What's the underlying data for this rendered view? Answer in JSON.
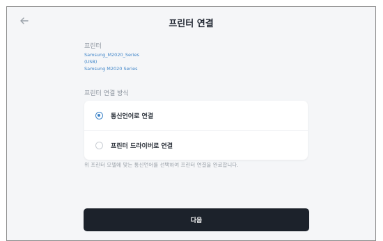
{
  "header": {
    "title": "프린터 연결",
    "back_icon": "arrow-left-icon"
  },
  "printer": {
    "label": "프린터",
    "name": "Samsung_M2020_Series",
    "connection": "(USB)",
    "model": "Samsung M2020 Series"
  },
  "method": {
    "label": "프린터 연결 방식",
    "options": [
      {
        "label": "통신언어로 연결",
        "selected": true
      },
      {
        "label": "프린터 드라이버로 연결",
        "selected": false
      }
    ]
  },
  "helper_text": "위 프린터 모델에 맞는 통신언어를 선택하여 프린터 연결을 완료합니다.",
  "footer": {
    "next_label": "다음"
  },
  "colors": {
    "accent": "#3e84c8",
    "primary_button": "#1c222b",
    "background": "#f5f6f8"
  }
}
